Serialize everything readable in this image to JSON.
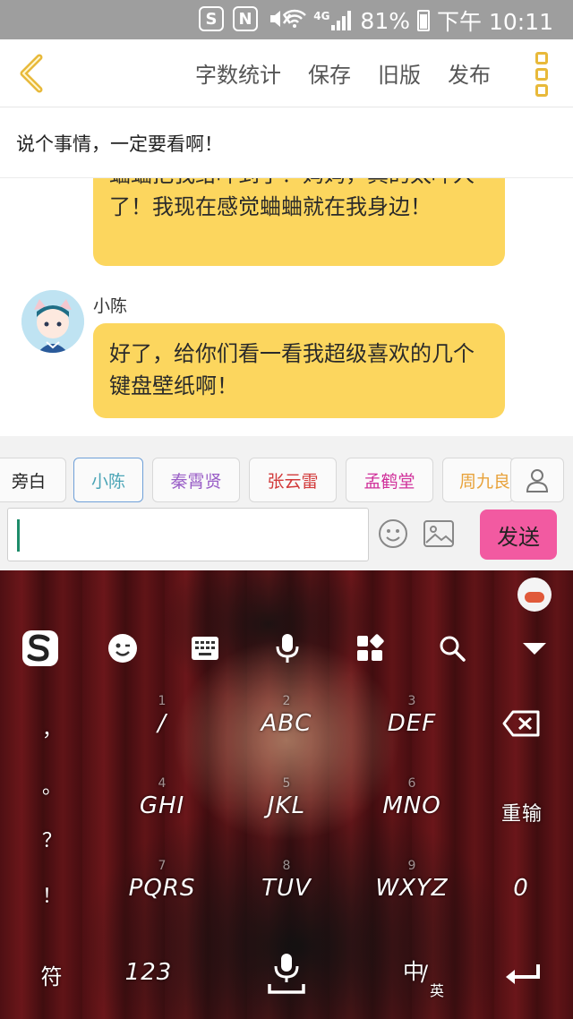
{
  "status_bar": {
    "network": "4G",
    "battery": "81%",
    "time": "下午 10:11"
  },
  "topbar": {
    "word_count": "字数统计",
    "save": "保存",
    "old_version": "旧版",
    "publish": "发布"
  },
  "story_title": "说个事情，一定要看啊！",
  "messages": [
    {
      "text": "蛐蛐把我给吓到了！妈妈，真的太吓人了！我现在感觉蛐蛐就在我身边！"
    },
    {
      "sender": "小陈",
      "text": "好了，给你们看一看我超级喜欢的几个键盘壁纸啊！"
    }
  ],
  "roles": [
    {
      "label": "旁白",
      "color": "#555555"
    },
    {
      "label": "小陈",
      "color": "#4aa4b6",
      "active": true
    },
    {
      "label": "秦霄贤",
      "color": "#9a5fc7"
    },
    {
      "label": "张云雷",
      "color": "#d23a3a"
    },
    {
      "label": "孟鹤堂",
      "color": "#d0309a"
    },
    {
      "label": "周九良",
      "color": "#e8a23a"
    }
  ],
  "input": {
    "value": "",
    "send_label": "发送"
  },
  "keyboard": {
    "side_chars": [
      "，",
      "。",
      "？",
      "！"
    ],
    "keys": [
      {
        "num": "1",
        "label": "/"
      },
      {
        "num": "2",
        "label": "ABC"
      },
      {
        "num": "3",
        "label": "DEF"
      },
      {
        "num": "4",
        "label": "GHI"
      },
      {
        "num": "5",
        "label": "JKL"
      },
      {
        "num": "6",
        "label": "MNO"
      },
      {
        "num": "7",
        "label": "PQRS"
      },
      {
        "num": "8",
        "label": "TUV"
      },
      {
        "num": "9",
        "label": "WXYZ"
      },
      {
        "num": "",
        "label": "0"
      }
    ],
    "reenter": "重输",
    "symbols": "符",
    "numbers": "123",
    "lang_zh": "中",
    "lang_en": "英"
  }
}
